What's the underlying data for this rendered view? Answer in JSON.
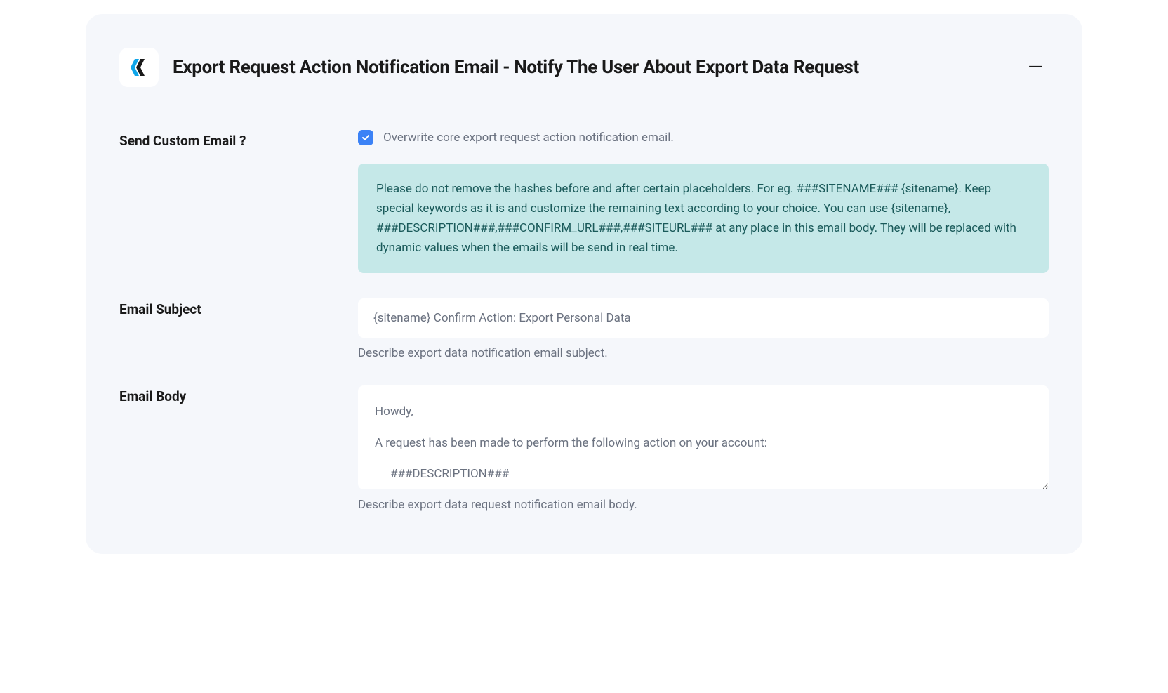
{
  "header": {
    "title": "Export Request Action Notification Email - Notify The User About Export Data Request"
  },
  "sections": {
    "sendCustomEmail": {
      "label": "Send Custom Email ?",
      "checkboxLabel": "Overwrite core export request action notification email.",
      "infoText": "Please do not remove the hashes before and after certain placeholders. For eg. ###SITENAME### {sitename}. Keep special keywords as it is and customize the remaining text according to your choice. You can use {sitename}, ###DESCRIPTION###,###CONFIRM_URL###,###SITEURL### at any place in this email body. They will be replaced with dynamic values when the emails will be send in real time."
    },
    "emailSubject": {
      "label": "Email Subject",
      "value": "{sitename} Confirm Action: Export Personal Data",
      "helper": "Describe export data notification email subject."
    },
    "emailBody": {
      "label": "Email Body",
      "line1": "Howdy,",
      "line2": "A request has been made to perform the following action on your account:",
      "line3": "###DESCRIPTION###",
      "helper": "Describe export data request notification email body."
    }
  }
}
